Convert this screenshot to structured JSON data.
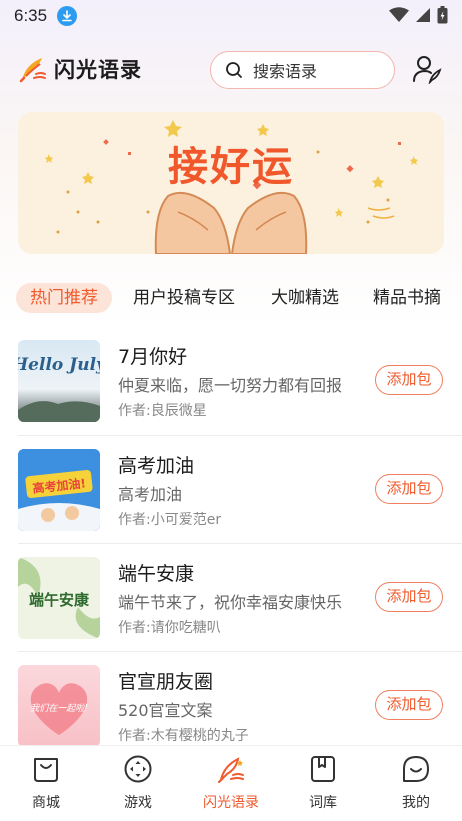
{
  "status_bar": {
    "time": "6:35"
  },
  "header": {
    "app_name": "闪光语录",
    "search_placeholder": "搜索语录"
  },
  "banner": {
    "title": "接好运"
  },
  "tabs": [
    {
      "label": "热门推荐",
      "active": true
    },
    {
      "label": "用户投稿专区",
      "active": false
    },
    {
      "label": "大咖精选",
      "active": false
    },
    {
      "label": "精品书摘",
      "active": false
    }
  ],
  "list": [
    {
      "title": "7月你好",
      "desc": "仲夏来临，愿一切努力都有回报",
      "author": "作者:良辰微星",
      "button": "添加包",
      "thumb_text": "Hello July"
    },
    {
      "title": "高考加油",
      "desc": "高考加油",
      "author": "作者:小可爱范er",
      "button": "添加包",
      "thumb_text": "高考加油!"
    },
    {
      "title": "端午安康",
      "desc": "端午节来了，祝你幸福安康快乐",
      "author": "作者:请你吃糖叭",
      "button": "添加包",
      "thumb_text": "端午安康"
    },
    {
      "title": "官宣朋友圈",
      "desc": "520官宣文案",
      "author": "作者:木有樱桃的丸子",
      "button": "添加包",
      "thumb_text": "我们在一起啦!"
    }
  ],
  "bottom_nav": [
    {
      "label": "商城",
      "icon": "bag-icon",
      "active": false
    },
    {
      "label": "游戏",
      "icon": "gamepad-icon",
      "active": false
    },
    {
      "label": "闪光语录",
      "icon": "feather-icon",
      "active": true
    },
    {
      "label": "词库",
      "icon": "book-icon",
      "active": false
    },
    {
      "label": "我的",
      "icon": "smile-icon",
      "active": false
    }
  ],
  "colors": {
    "accent": "#f05a2c",
    "tab_active_bg": "#fde4d8",
    "banner_bg": "#fbf1de"
  }
}
